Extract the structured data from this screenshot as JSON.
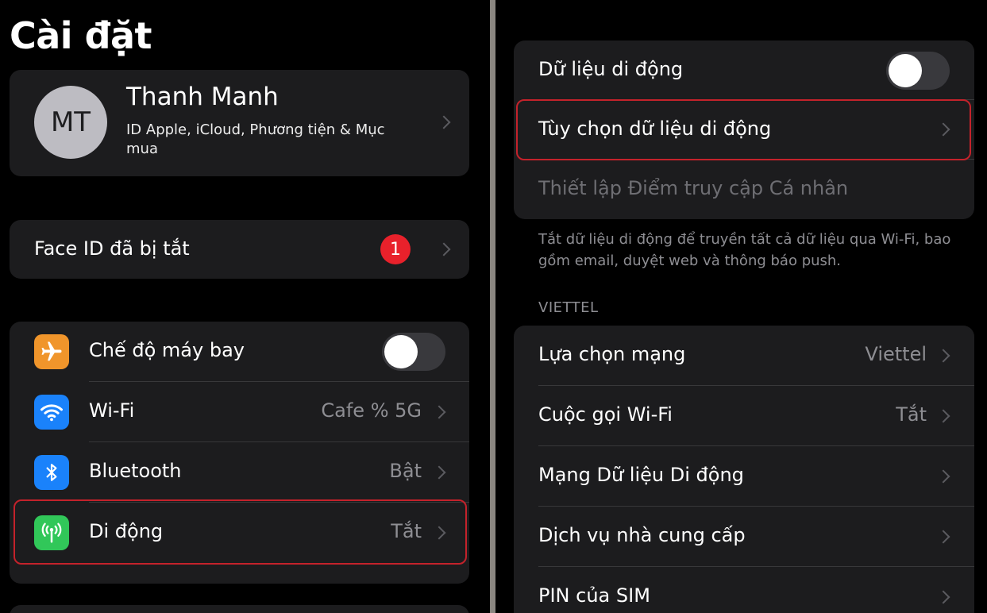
{
  "left": {
    "title": "Cài đặt",
    "profile": {
      "initials": "MT",
      "name": "Thanh Manh",
      "subtitle": "ID Apple, iCloud, Phương tiện & Mục mua"
    },
    "faceid": {
      "label": "Face ID đã bị tắt",
      "badge": "1"
    },
    "rows": [
      {
        "label": "Chế độ máy bay",
        "icon": "airplane-icon",
        "icon_color": "#f0952b",
        "toggle": "off"
      },
      {
        "label": "Wi-Fi",
        "icon": "wifi-icon",
        "icon_color": "#1a82fb",
        "value": "Cafe % 5G"
      },
      {
        "label": "Bluetooth",
        "icon": "bluetooth-icon",
        "icon_color": "#1a82fb",
        "value": "Bật"
      },
      {
        "label": "Di động",
        "icon": "cellular-icon",
        "icon_color": "#31c759",
        "value": "Tắt"
      }
    ]
  },
  "right": {
    "group1": [
      {
        "label": "Dữ liệu di động",
        "toggle": "off"
      },
      {
        "label": "Tùy chọn dữ liệu di động"
      },
      {
        "label": "Thiết lập Điểm truy cập Cá nhân",
        "disabled": true
      }
    ],
    "note": "Tắt dữ liệu di động để truyền tất cả dữ liệu qua Wi-Fi, bao gồm email, duyệt web và thông báo push.",
    "section_header": "VIETTEL",
    "group2": [
      {
        "label": "Lựa chọn mạng",
        "value": "Viettel"
      },
      {
        "label": "Cuộc gọi Wi-Fi",
        "value": "Tắt"
      },
      {
        "label": "Mạng Dữ liệu Di động"
      },
      {
        "label": "Dịch vụ nhà cung cấp"
      },
      {
        "label": "PIN của SIM"
      }
    ]
  },
  "colors": {
    "background": "#000000",
    "cell": "#1c1c1e",
    "highlight": "#c4222b",
    "badge": "#e8212b"
  }
}
